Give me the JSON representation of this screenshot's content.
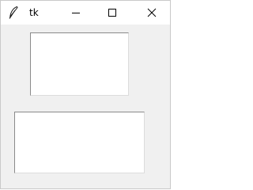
{
  "window": {
    "title": "tk",
    "icon": "feather-icon",
    "controls": {
      "minimize": "minimize-icon",
      "maximize": "maximize-icon",
      "close": "close-icon"
    }
  },
  "content": {
    "text_area_1": {
      "value": ""
    },
    "text_area_2": {
      "value": ""
    }
  },
  "colors": {
    "titlebar": "#ffffff",
    "client_background": "#f0f0f0",
    "text_area_background": "#ffffff"
  }
}
